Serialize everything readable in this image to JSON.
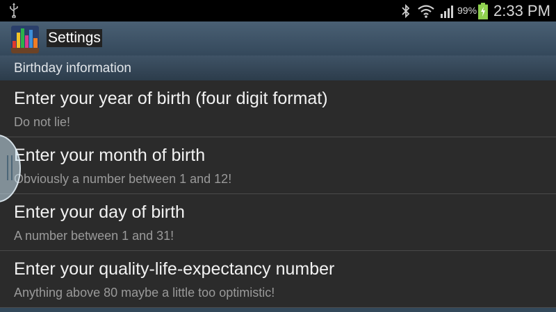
{
  "status_bar": {
    "icons": [
      "usb-icon",
      "bluetooth-icon",
      "wifi-icon",
      "signal-icon",
      "battery-icon"
    ],
    "battery_percent": "99%",
    "time": "2:33 PM"
  },
  "action_bar": {
    "title": "Settings",
    "icon": "app-icon"
  },
  "section": {
    "header": "Birthday information"
  },
  "preferences": [
    {
      "title": "Enter your year of birth (four digit format)",
      "summary": "Do not lie!"
    },
    {
      "title": "Enter your month of birth",
      "summary": "Obviously a number between 1 and 12!"
    },
    {
      "title": "Enter your day of birth",
      "summary": "A number between 1 and 31!"
    },
    {
      "title": "Enter your quality-life-expectancy number",
      "summary": "Anything above 80 maybe a little too optimistic!"
    }
  ],
  "colors": {
    "background": "#2b2b2b",
    "action_bar": "#4a6074",
    "section_header": "#3f5366",
    "battery_charging": "#8fd14f"
  }
}
